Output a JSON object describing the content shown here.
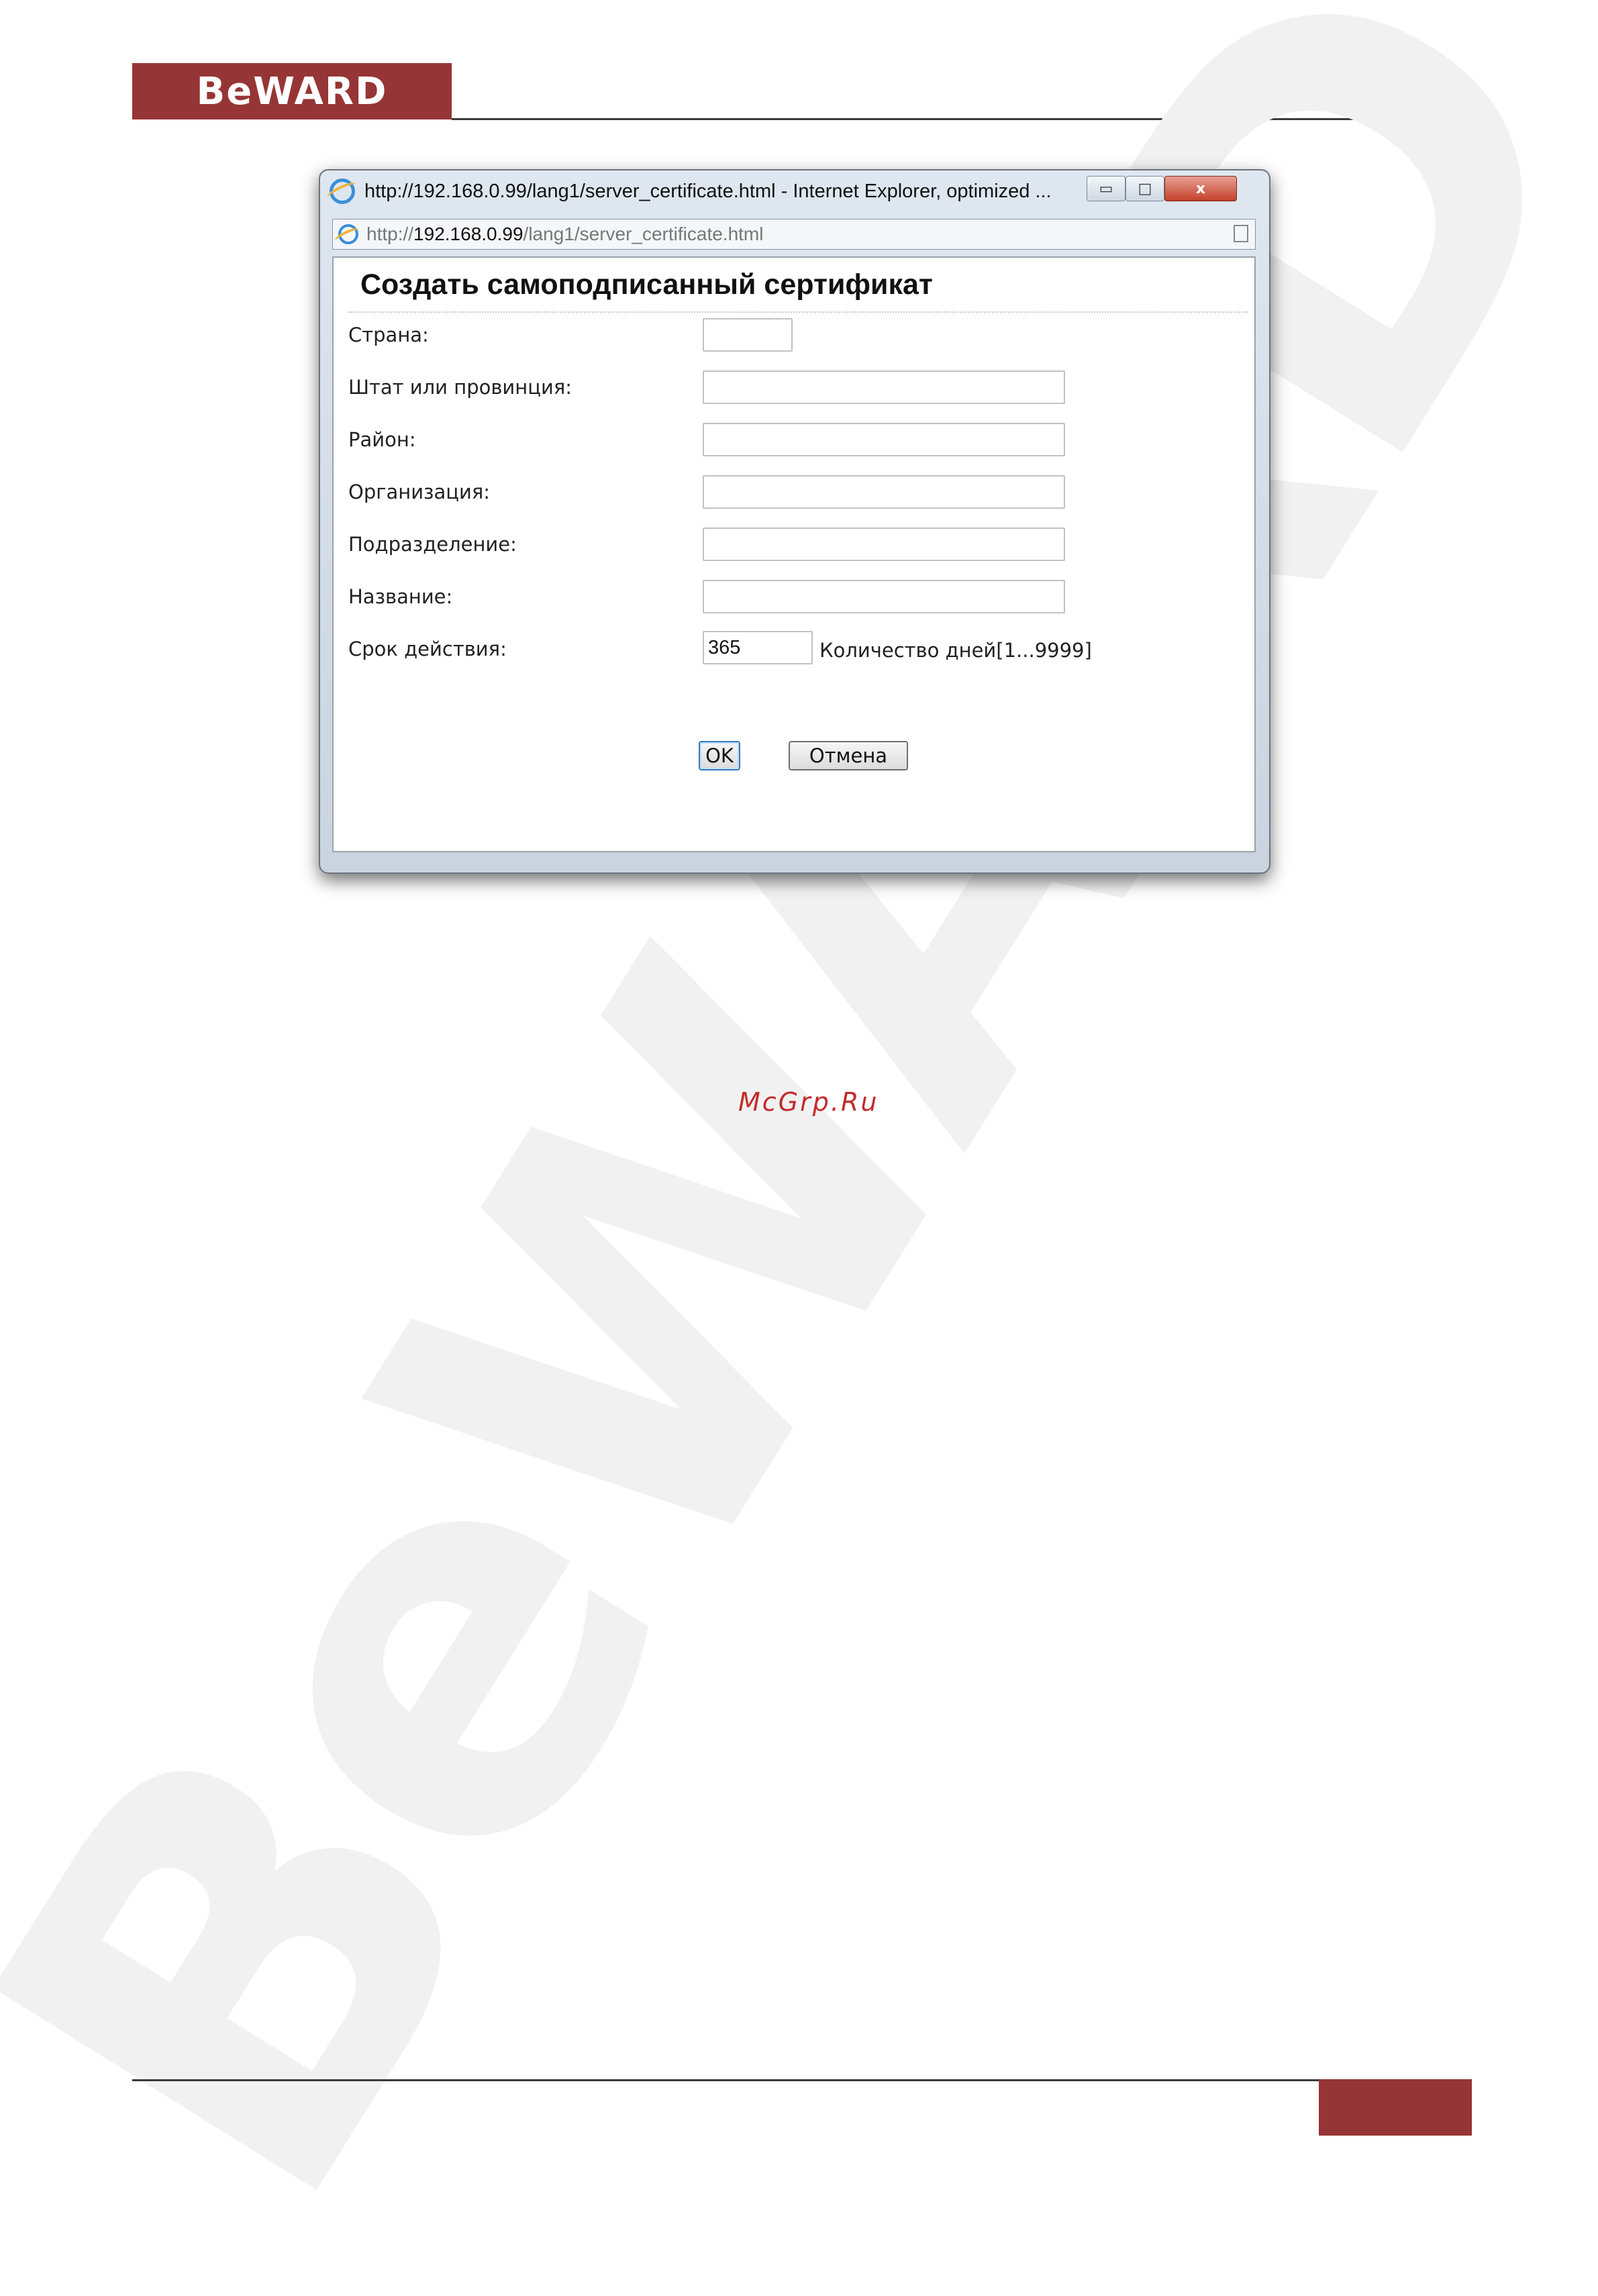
{
  "brand": {
    "logo_text": "BeWARD",
    "watermark_text": "BeWARD",
    "accent_color": "#963535"
  },
  "window": {
    "title": "http://192.168.0.99/lang1/server_certificate.html - Internet Explorer, optimized ...",
    "address_prefix": "http://",
    "address_host": "192.168.0.99",
    "address_path": "/lang1/server_certificate.html",
    "close_glyph": "x",
    "minimize_glyph": "▭",
    "maximize_glyph": "□"
  },
  "dialog": {
    "title": "Создать самоподписанный сертификат",
    "fields": {
      "country_label": "Страна:",
      "state_label": "Штат или провинция:",
      "district_label": "Район:",
      "organization_label": "Организация:",
      "department_label": "Подразделение:",
      "name_label": "Название:",
      "validity_label": "Срок действия:",
      "validity_value": "365",
      "validity_hint": "Количество дней[1...9999]"
    },
    "ok_label": "OK",
    "cancel_label": "Отмена"
  },
  "source_text": "McGrp.Ru"
}
